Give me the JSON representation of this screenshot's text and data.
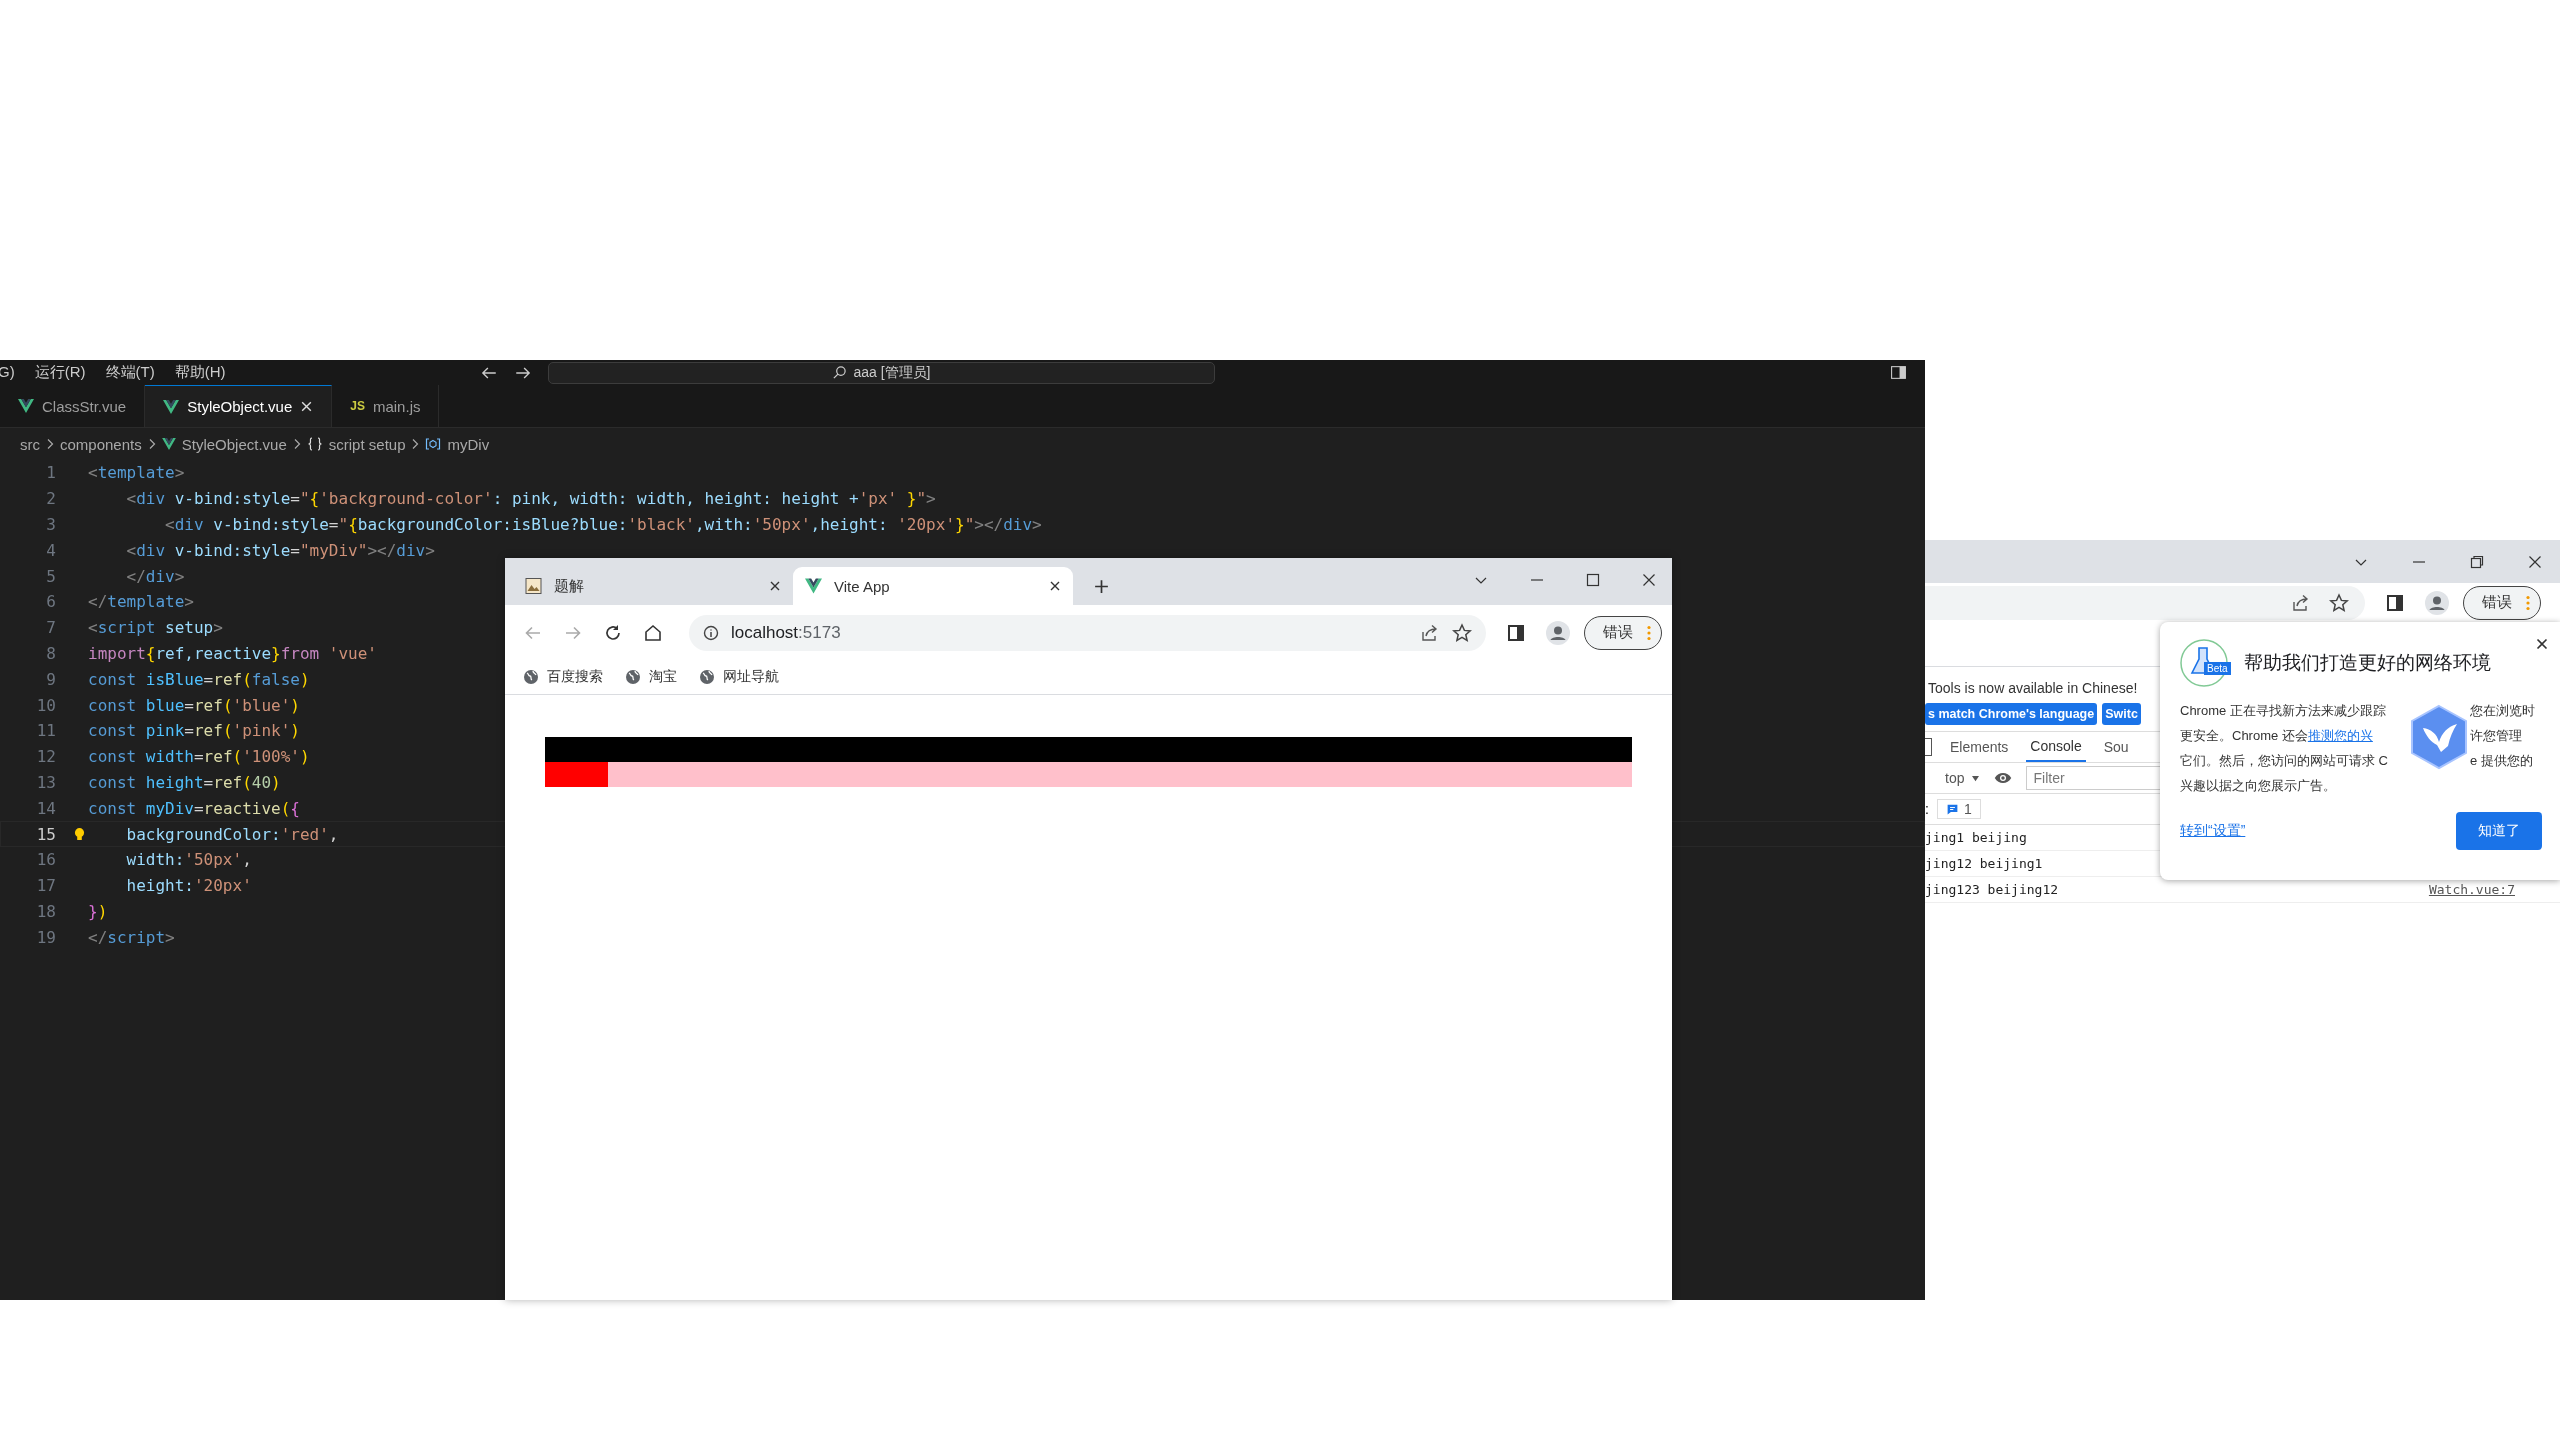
{
  "editor": {
    "menu": [
      "G)",
      "运行(R)",
      "终端(T)",
      "帮助(H)"
    ],
    "command_center": "aaa [管理员]",
    "tabs": [
      {
        "label": "ClassStr.vue",
        "kind": "vue",
        "selected": false
      },
      {
        "label": "StyleObject.vue",
        "kind": "vue",
        "selected": true
      },
      {
        "label": "main.js",
        "kind": "js",
        "badge": "JS",
        "selected": false
      }
    ],
    "breadcrumb": [
      {
        "label": "src",
        "kind": "folder"
      },
      {
        "label": "components",
        "kind": "folder"
      },
      {
        "label": "StyleObject.vue",
        "kind": "vue"
      },
      {
        "label": "script setup",
        "kind": "braces"
      },
      {
        "label": "myDiv",
        "kind": "symbol"
      }
    ],
    "lines": [
      {
        "number": "1",
        "current": false,
        "tokens": [
          {
            "text": "<",
            "kind": "punc"
          },
          {
            "text": "template",
            "kind": "tag"
          },
          {
            "text": ">",
            "kind": "punc"
          }
        ]
      },
      {
        "number": "2",
        "current": false,
        "tokens": [
          {
            "text": "    <",
            "kind": "punc"
          },
          {
            "text": "div",
            "kind": "tag"
          },
          {
            "text": " v-bind:style",
            "kind": "attr"
          },
          {
            "text": "=",
            "kind": "plain"
          },
          {
            "text": "\"",
            "kind": "str"
          },
          {
            "text": "{",
            "kind": "bracket"
          },
          {
            "text": "'background-color'",
            "kind": "str"
          },
          {
            "text": ": pink, width: width, height: height +",
            "kind": "attr"
          },
          {
            "text": "'px'",
            "kind": "str"
          },
          {
            "text": " }",
            "kind": "bracket"
          },
          {
            "text": "\"",
            "kind": "str"
          },
          {
            "text": ">",
            "kind": "punc"
          }
        ]
      },
      {
        "number": "3",
        "current": false,
        "tokens": [
          {
            "text": "        <",
            "kind": "punc"
          },
          {
            "text": "div",
            "kind": "tag"
          },
          {
            "text": " v-bind:style",
            "kind": "attr"
          },
          {
            "text": "=",
            "kind": "plain"
          },
          {
            "text": "\"",
            "kind": "str"
          },
          {
            "text": "{",
            "kind": "bracket"
          },
          {
            "text": "backgroundColor:isBlue?blue:",
            "kind": "attr"
          },
          {
            "text": "'black'",
            "kind": "str"
          },
          {
            "text": ",with:",
            "kind": "attr"
          },
          {
            "text": "'50px'",
            "kind": "str"
          },
          {
            "text": ",height: ",
            "kind": "attr"
          },
          {
            "text": "'20px'",
            "kind": "str"
          },
          {
            "text": "}",
            "kind": "bracket"
          },
          {
            "text": "\"",
            "kind": "str"
          },
          {
            "text": "></",
            "kind": "punc"
          },
          {
            "text": "div",
            "kind": "tag"
          },
          {
            "text": ">",
            "kind": "punc"
          }
        ]
      },
      {
        "number": "4",
        "current": false,
        "tokens": [
          {
            "text": "    <",
            "kind": "punc"
          },
          {
            "text": "div",
            "kind": "tag"
          },
          {
            "text": " v-bind:style",
            "kind": "attr"
          },
          {
            "text": "=",
            "kind": "plain"
          },
          {
            "text": "\"myDiv\"",
            "kind": "str"
          },
          {
            "text": "></",
            "kind": "punc"
          },
          {
            "text": "div",
            "kind": "tag"
          },
          {
            "text": ">",
            "kind": "punc"
          }
        ]
      },
      {
        "number": "5",
        "current": false,
        "tokens": [
          {
            "text": "    </",
            "kind": "punc"
          },
          {
            "text": "div",
            "kind": "tag"
          },
          {
            "text": ">",
            "kind": "punc"
          }
        ]
      },
      {
        "number": "6",
        "current": false,
        "tokens": [
          {
            "text": "</",
            "kind": "punc"
          },
          {
            "text": "template",
            "kind": "tag"
          },
          {
            "text": ">",
            "kind": "punc"
          }
        ]
      },
      {
        "number": "7",
        "current": false,
        "tokens": [
          {
            "text": "<",
            "kind": "punc"
          },
          {
            "text": "script",
            "kind": "tag"
          },
          {
            "text": " setup",
            "kind": "attr"
          },
          {
            "text": ">",
            "kind": "punc"
          }
        ]
      },
      {
        "number": "8",
        "current": false,
        "tokens": [
          {
            "text": "import",
            "kind": "control"
          },
          {
            "text": "{",
            "kind": "bracket"
          },
          {
            "text": "ref,reactive",
            "kind": "attr"
          },
          {
            "text": "}",
            "kind": "bracket"
          },
          {
            "text": "from",
            "kind": "control"
          },
          {
            "text": " 'vue'",
            "kind": "str"
          }
        ]
      },
      {
        "number": "9",
        "current": false,
        "tokens": [
          {
            "text": "const",
            "kind": "keyword"
          },
          {
            "text": " isBlue",
            "kind": "var"
          },
          {
            "text": "=",
            "kind": "plain"
          },
          {
            "text": "ref",
            "kind": "func"
          },
          {
            "text": "(",
            "kind": "bracket"
          },
          {
            "text": "false",
            "kind": "keyword"
          },
          {
            "text": ")",
            "kind": "bracket"
          }
        ]
      },
      {
        "number": "10",
        "current": false,
        "tokens": [
          {
            "text": "const",
            "kind": "keyword"
          },
          {
            "text": " blue",
            "kind": "var"
          },
          {
            "text": "=",
            "kind": "plain"
          },
          {
            "text": "ref",
            "kind": "func"
          },
          {
            "text": "(",
            "kind": "bracket"
          },
          {
            "text": "'blue'",
            "kind": "str"
          },
          {
            "text": ")",
            "kind": "bracket"
          }
        ]
      },
      {
        "number": "11",
        "current": false,
        "tokens": [
          {
            "text": "const",
            "kind": "keyword"
          },
          {
            "text": " pink",
            "kind": "var"
          },
          {
            "text": "=",
            "kind": "plain"
          },
          {
            "text": "ref",
            "kind": "func"
          },
          {
            "text": "(",
            "kind": "bracket"
          },
          {
            "text": "'pink'",
            "kind": "str"
          },
          {
            "text": ")",
            "kind": "bracket"
          }
        ]
      },
      {
        "number": "12",
        "current": false,
        "tokens": [
          {
            "text": "const",
            "kind": "keyword"
          },
          {
            "text": " width",
            "kind": "var"
          },
          {
            "text": "=",
            "kind": "plain"
          },
          {
            "text": "ref",
            "kind": "func"
          },
          {
            "text": "(",
            "kind": "bracket"
          },
          {
            "text": "'100%'",
            "kind": "str"
          },
          {
            "text": ")",
            "kind": "bracket"
          }
        ]
      },
      {
        "number": "13",
        "current": false,
        "tokens": [
          {
            "text": "const",
            "kind": "keyword"
          },
          {
            "text": " height",
            "kind": "var"
          },
          {
            "text": "=",
            "kind": "plain"
          },
          {
            "text": "ref",
            "kind": "func"
          },
          {
            "text": "(",
            "kind": "bracket"
          },
          {
            "text": "40",
            "kind": "num"
          },
          {
            "text": ")",
            "kind": "bracket"
          }
        ]
      },
      {
        "number": "14",
        "current": false,
        "tokens": [
          {
            "text": "const",
            "kind": "keyword"
          },
          {
            "text": " myDiv",
            "kind": "var"
          },
          {
            "text": "=",
            "kind": "plain"
          },
          {
            "text": "reactive",
            "kind": "func"
          },
          {
            "text": "(",
            "kind": "bracket"
          },
          {
            "text": "{",
            "kind": "bracket2"
          }
        ]
      },
      {
        "number": "15",
        "current": true,
        "tokens": [
          {
            "text": "    backgroundColor:",
            "kind": "attr"
          },
          {
            "text": "'red'",
            "kind": "str"
          },
          {
            "text": ",",
            "kind": "plain"
          }
        ]
      },
      {
        "number": "16",
        "current": false,
        "tokens": [
          {
            "text": "    width:",
            "kind": "attr"
          },
          {
            "text": "'50px'",
            "kind": "str"
          },
          {
            "text": ",",
            "kind": "plain"
          }
        ]
      },
      {
        "number": "17",
        "current": false,
        "tokens": [
          {
            "text": "    height:",
            "kind": "attr"
          },
          {
            "text": "'20px'",
            "kind": "str"
          }
        ]
      },
      {
        "number": "18",
        "current": false,
        "tokens": [
          {
            "text": "}",
            "kind": "bracket2"
          },
          {
            "text": ")",
            "kind": "bracket"
          }
        ]
      },
      {
        "number": "19",
        "current": false,
        "tokens": [
          {
            "text": "</",
            "kind": "punc"
          },
          {
            "text": "script",
            "kind": "tag"
          },
          {
            "text": ">",
            "kind": "punc"
          }
        ]
      }
    ]
  },
  "browser": {
    "tabs": [
      {
        "title": "题解",
        "kind": "image",
        "selected": false
      },
      {
        "title": "Vite App",
        "kind": "vue",
        "selected": true
      }
    ],
    "address": {
      "host": "localhost",
      "port": ":5173"
    },
    "profile_pill": "错误",
    "bookmarks": [
      "百度搜索",
      "淘宝",
      "网址导航"
    ]
  },
  "second_browser": {
    "profile_pill": "错误",
    "devtools": {
      "banner": "Tools is now available in Chinese!",
      "buttons": [
        "s match Chrome's language",
        "Switc"
      ],
      "tabs": [
        {
          "label": "Elements",
          "selected": false
        },
        {
          "label": "Console",
          "selected": true
        },
        {
          "label": "Sou",
          "selected": false
        }
      ],
      "context": "top",
      "filter_placeholder": "Filter",
      "prefix": ":",
      "message_count": "1",
      "logs": [
        {
          "text": "jing1 beijing"
        },
        {
          "text": "jing12 beijing1"
        },
        {
          "text": "jing123 beijing12",
          "source": "Watch.vue:7"
        }
      ]
    },
    "popup": {
      "badge": "Beta",
      "title": "帮助我们打造更好的网络环境",
      "lines": [
        [
          {
            "kind": "text",
            "text": "Chrome 正在寻找新方法来减少跟踪"
          },
          {
            "kind": "gap"
          },
          {
            "kind": "text",
            "text": "您在浏览时"
          }
        ],
        [
          {
            "kind": "text",
            "text": "更安全。Chrome 还会"
          },
          {
            "kind": "link",
            "text": "推测您的兴"
          },
          {
            "kind": "gap"
          },
          {
            "kind": "text",
            "text": "许您管理"
          }
        ],
        [
          {
            "kind": "text",
            "text": "它们。然后，您访问的网站可请求 C"
          },
          {
            "kind": "gap"
          },
          {
            "kind": "text",
            "text": "e 提供您的"
          }
        ],
        [
          {
            "kind": "text",
            "text": "兴趣以据之向您展示广告。"
          }
        ]
      ],
      "link": "转到“设置”",
      "button": "知道了"
    }
  }
}
